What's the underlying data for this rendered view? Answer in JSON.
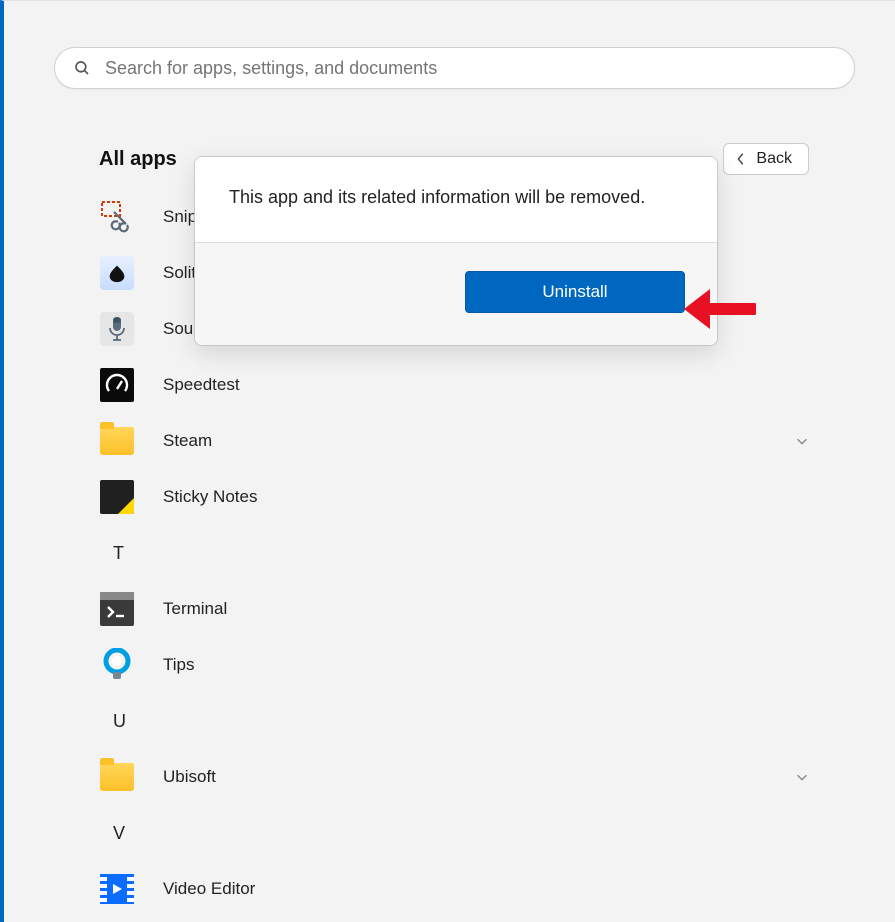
{
  "search": {
    "placeholder": "Search for apps, settings, and documents"
  },
  "header": {
    "title": "All apps",
    "back_label": "Back"
  },
  "dialog": {
    "message": "This app and its related information will be removed.",
    "uninstall_label": "Uninstall"
  },
  "apps": {
    "snipping": "Snipping Tool",
    "solitaire": "Solitaire",
    "sound": "Sound Recorder",
    "speedtest": "Speedtest",
    "steam": "Steam",
    "sticky": "Sticky Notes",
    "terminal": "Terminal",
    "tips": "Tips",
    "ubisoft": "Ubisoft",
    "video_editor": "Video Editor"
  },
  "sections": {
    "t": "T",
    "u": "U",
    "v": "V"
  }
}
